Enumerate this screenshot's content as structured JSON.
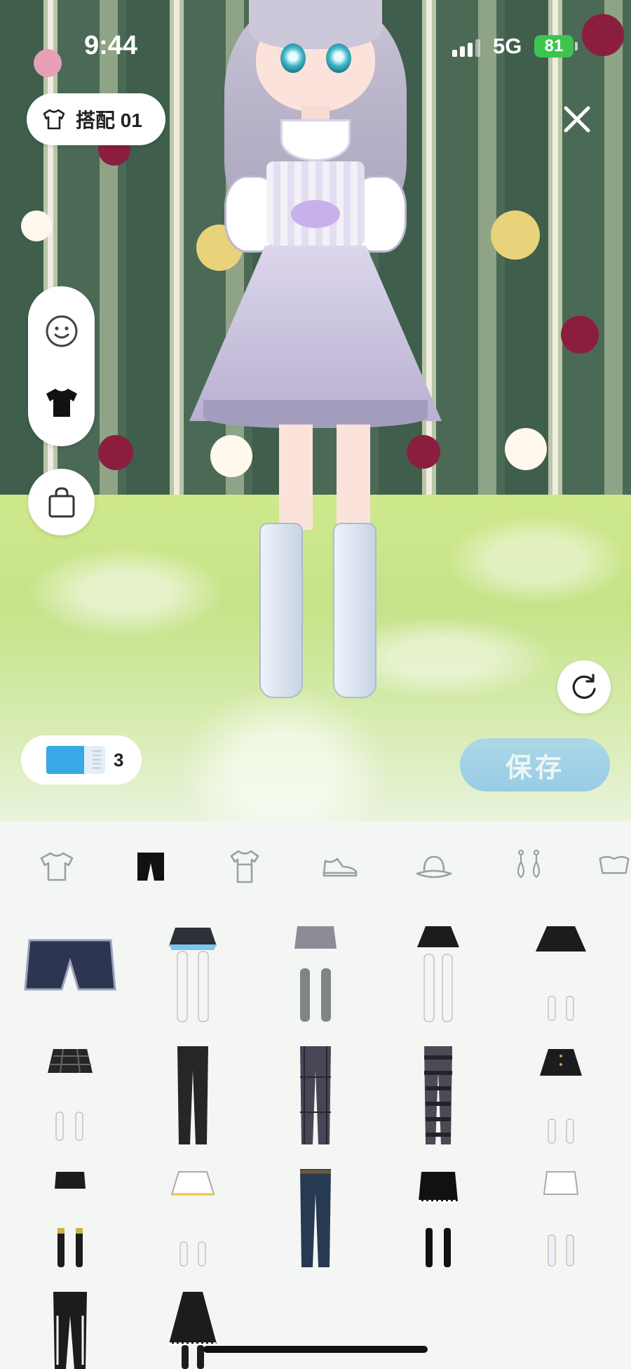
{
  "status_bar": {
    "time": "9:44",
    "network": "5G",
    "battery": "81"
  },
  "header": {
    "outfit_label": "搭配 01"
  },
  "side_panel": {
    "items": [
      {
        "icon": "face-icon"
      },
      {
        "icon": "shirt-icon"
      }
    ]
  },
  "bottom_left": {
    "ticket_count": "3"
  },
  "actions": {
    "save_label": "保存"
  },
  "category_tabs": [
    {
      "icon": "tshirt-icon",
      "selected": false
    },
    {
      "icon": "pants-icon",
      "selected": true
    },
    {
      "icon": "dress-icon",
      "selected": false
    },
    {
      "icon": "shoe-icon",
      "selected": false
    },
    {
      "icon": "hat-icon",
      "selected": false
    },
    {
      "icon": "earrings-icon",
      "selected": false
    },
    {
      "icon": "accessory-icon",
      "selected": false
    }
  ],
  "closet_items": [
    "denim-shorts",
    "blue-frill-skirt-white-stockings",
    "grey-shorts-grey-socks",
    "black-skirt-white-stockings",
    "black-pleated-skirt-socks",
    "plaid-skirt-socks",
    "black-trousers",
    "plaid-trousers",
    "striped-leggings",
    "black-button-skirt-socks",
    "black-shorts-knee-socks",
    "white-skirt-socks",
    "blue-jeans",
    "black-bloomers-knee-socks",
    "white-bloomers-socks",
    "black-cutout-pants",
    "black-lace-skirt"
  ],
  "colors": {
    "accent_blue": "#8cc6ea",
    "battery_green": "#3dc44f",
    "selected_tab": "#111111",
    "inactive_tab": "#9aa0a6"
  }
}
